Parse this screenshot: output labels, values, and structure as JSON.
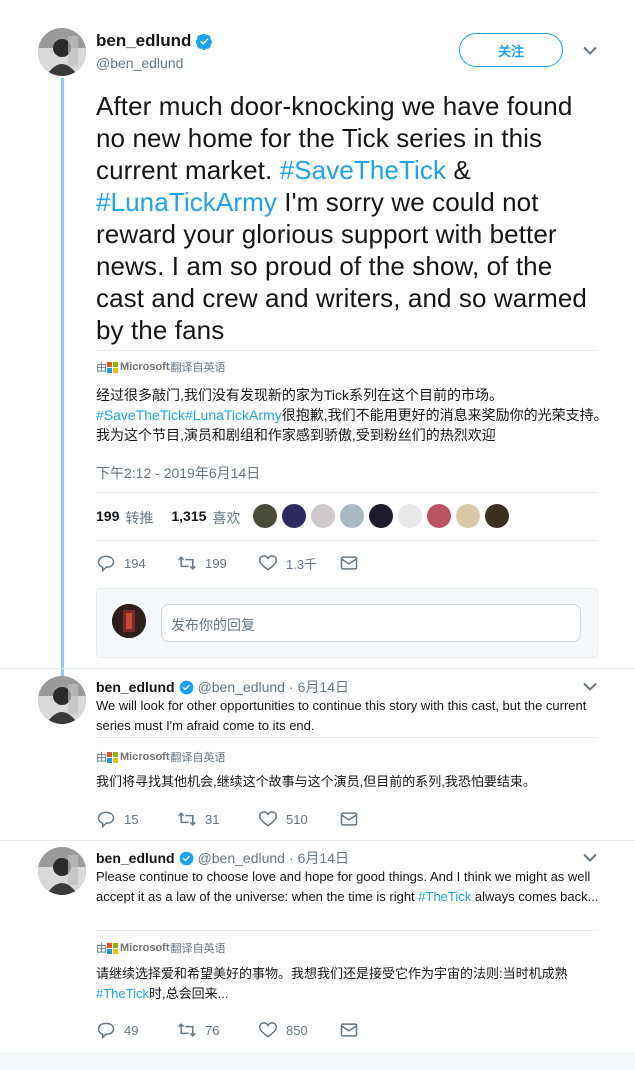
{
  "main_tweet": {
    "display_name": "ben_edlund",
    "handle": "@ben_edlund",
    "follow_label": "关注",
    "text_parts": {
      "p1": "After much door-knocking we have found no new home for the Tick series in this current market. ",
      "tag1": "#SaveTheTick",
      "p2": " & ",
      "tag2": "#LunaTickArmy",
      "p3": " I'm sorry we could not reward your glorious support with better news. I am so proud of the show, of the cast and crew and writers, and so warmed by the fans"
    },
    "translate_by": "由",
    "translate_brand": "Microsoft",
    "translate_suffix": "翻译自英语",
    "translation_parts": {
      "p1": "经过很多敲门,我们没有发现新的家为Tick系列在这个目前的市场。",
      "tag1": "#SaveTheTick",
      "tag2": "#LunaTickArmy",
      "p2": "很抱歉,我们不能用更好的消息来奖励你的光荣支持。我为这个节目,演员和剧组和作家感到骄傲,受到粉丝们的热烈欢迎"
    },
    "timestamp": "下午2:12 - 2019年6月14日",
    "retweets_count": "199",
    "retweets_label": "转推",
    "likes_count": "1,315",
    "likes_label": "喜欢",
    "actions": {
      "replies": "194",
      "retweets": "199",
      "likes": "1.3千"
    },
    "reply_placeholder": "发布你的回复"
  },
  "replies": [
    {
      "display_name": "ben_edlund",
      "handle": "@ben_edlund",
      "separator": "·",
      "date": "6月14日",
      "text": "We will look for other opportunities to continue this story with this cast, but the current series must I'm afraid come to its end.",
      "translate_by": "由",
      "translate_brand": "Microsoft",
      "translate_suffix": "翻译自英语",
      "translation": "我们将寻找其他机会,继续这个故事与这个演员,但目前的系列,我恐怕要结束。",
      "actions": {
        "replies": "15",
        "retweets": "31",
        "likes": "510"
      }
    },
    {
      "display_name": "ben_edlund",
      "handle": "@ben_edlund",
      "separator": "·",
      "date": "6月14日",
      "text_p1": "Please continue to choose love and hope for good things. And I think we might as well accept it as a law of the universe: when the time is right ",
      "text_tag": "#TheTick",
      "text_p2": " always comes back...",
      "translate_by": "由",
      "translate_brand": "Microsoft",
      "translate_suffix": "翻译自英语",
      "translation_p1": "请继续选择爱和希望美好的事物。我想我们还是接受它作为宇宙的法则:当时机成熟",
      "translation_tag": "#TheTick",
      "translation_p2": "时,总会回来...",
      "actions": {
        "replies": "49",
        "retweets": "76",
        "likes": "850"
      }
    }
  ],
  "colors": {
    "accent": "#1da1f2",
    "text": "#14171a",
    "muted": "#657786",
    "thread": "#8ecdf2"
  }
}
